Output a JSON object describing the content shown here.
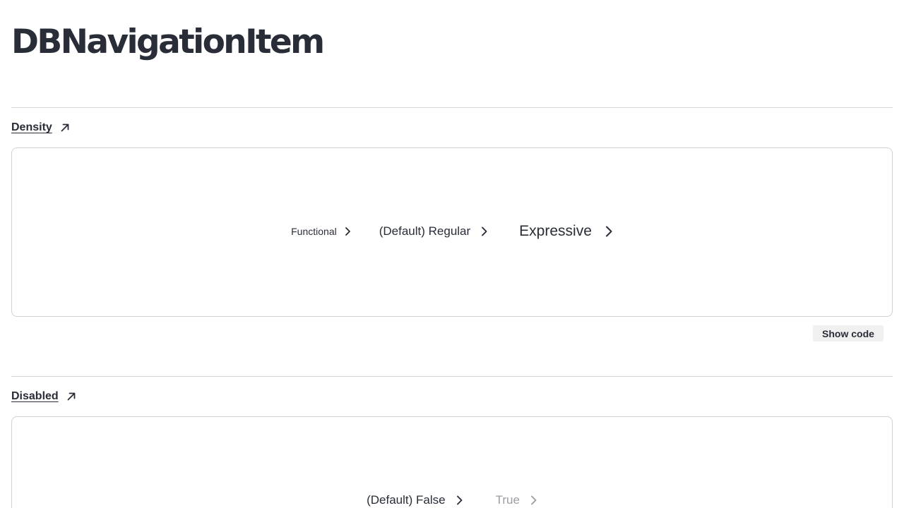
{
  "page": {
    "title": "DBNavigationItem"
  },
  "sections": {
    "density": {
      "heading": "Density",
      "items": {
        "functional": "Functional",
        "regular": "(Default) Regular",
        "expressive": "Expressive"
      },
      "show_code_label": "Show code"
    },
    "disabled": {
      "heading": "Disabled",
      "items": {
        "false_label": "(Default) False",
        "true_label": "True"
      }
    }
  },
  "icons": {
    "heading_link": "arrow-up-right-icon",
    "item_chevron": "chevron-right-icon"
  },
  "colors": {
    "text": "#282d37",
    "disabled_text": "#9b9ea4",
    "border": "#cfd1d5",
    "button_bg": "#f0f0f1"
  }
}
